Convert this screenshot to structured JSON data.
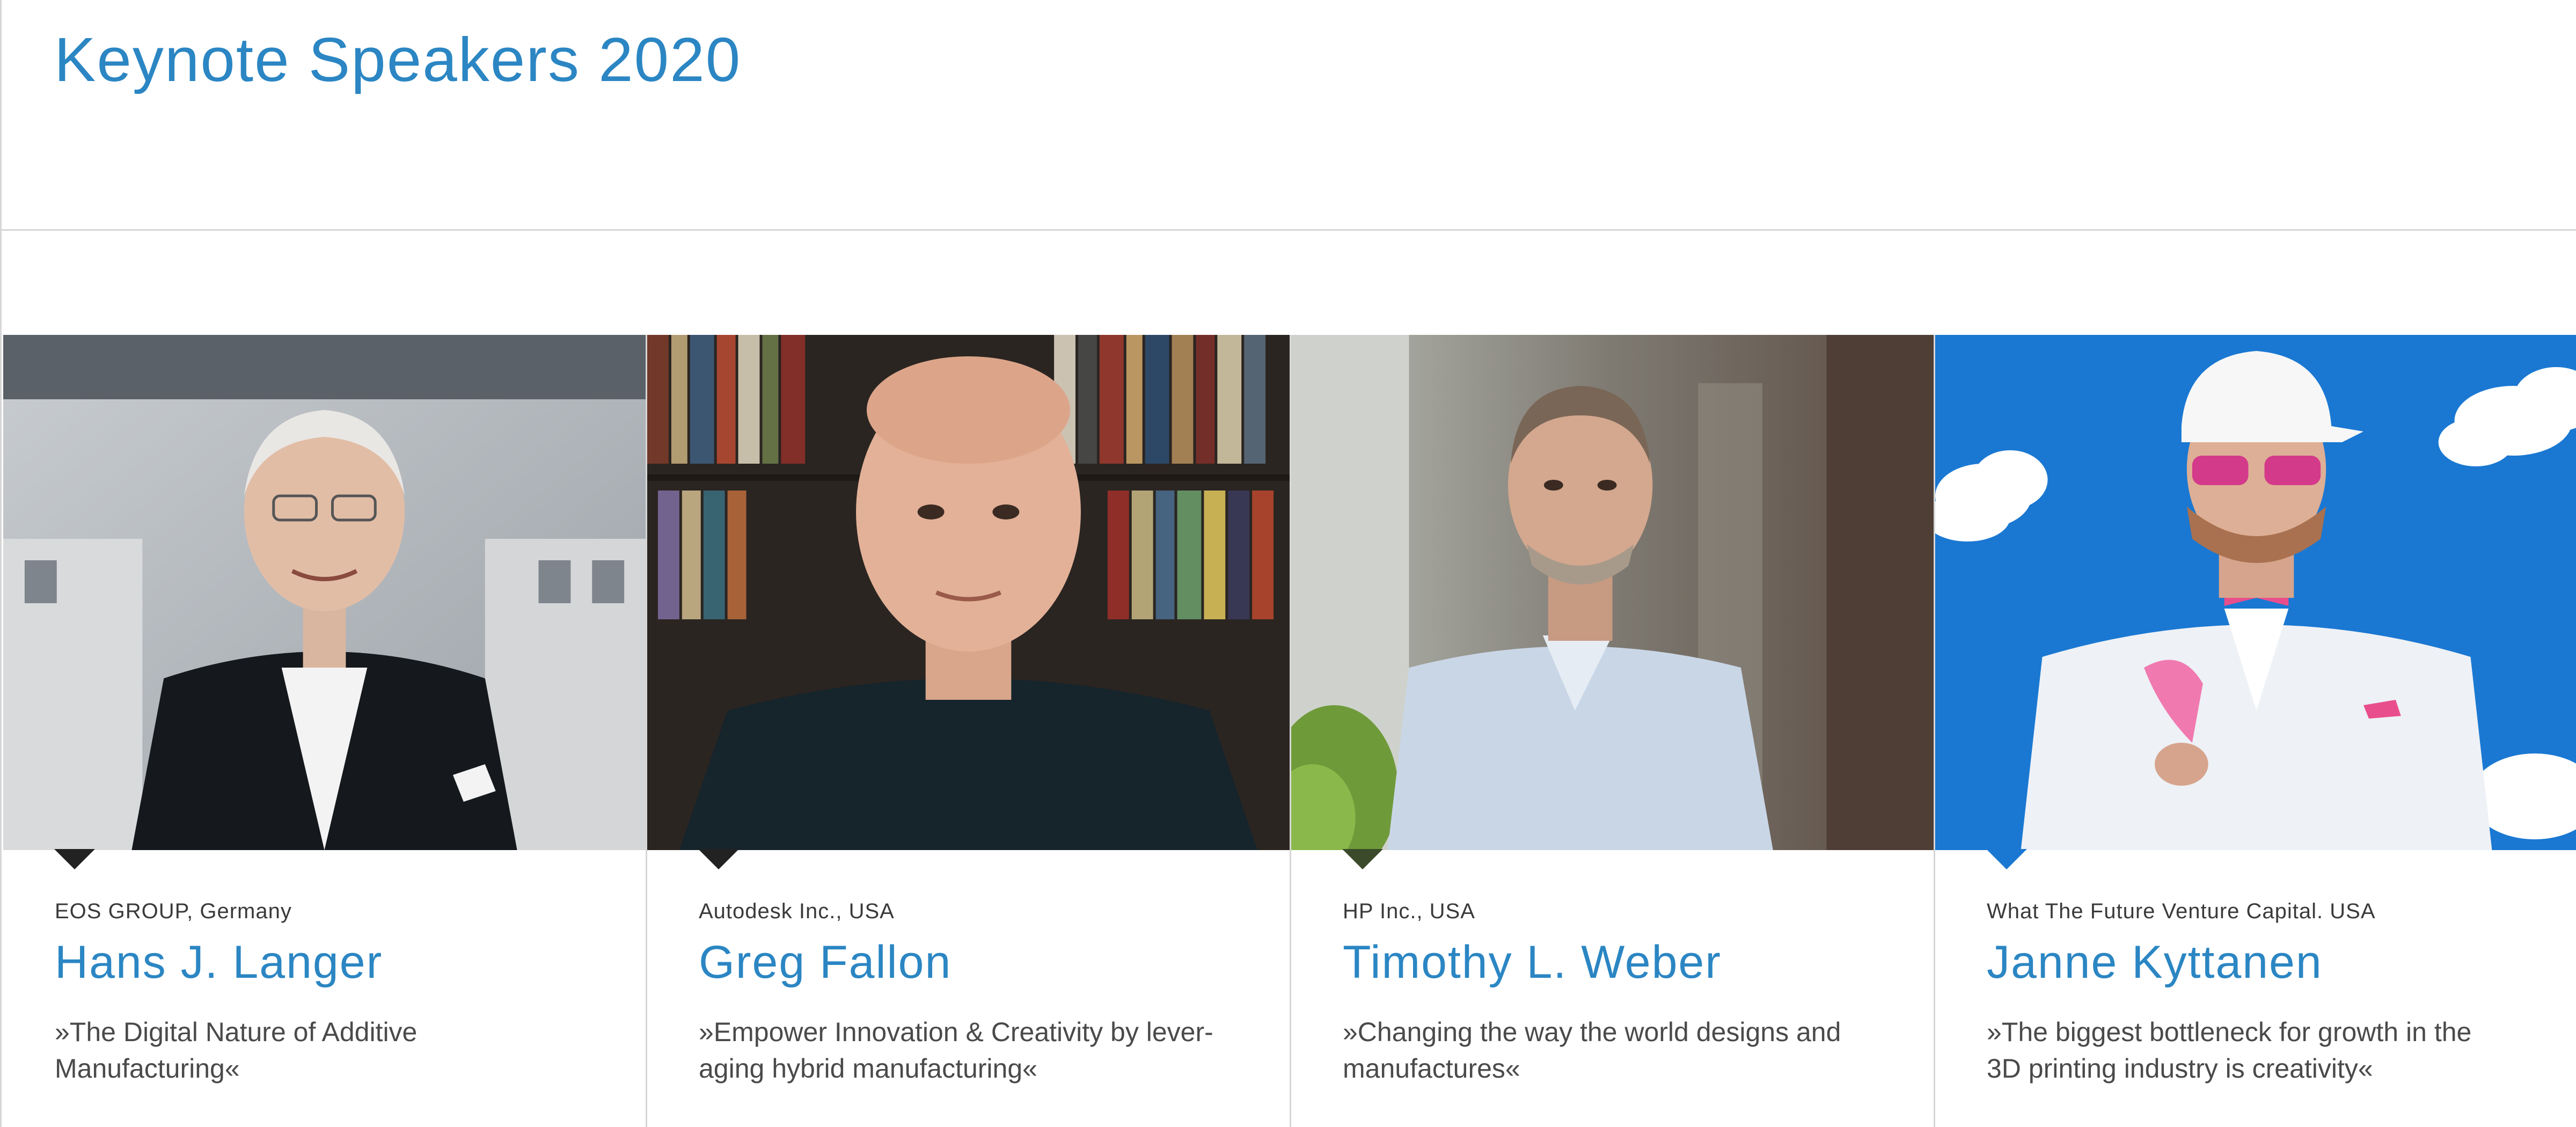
{
  "page": {
    "title": "Keynote Speakers 2020"
  },
  "speakers": [
    {
      "company": "EOS GROUP, Germany",
      "name": "Hans J. Langer",
      "quote_line1": "»The Digital Nature of Additive",
      "quote_line2": "Manufacturing«",
      "photo_icon": "portrait-photo"
    },
    {
      "company": "Autodesk Inc., USA",
      "name": "Greg Fallon",
      "quote_line1": "»Empower Innovation & Creativity by lever-",
      "quote_line2": "aging hybrid manufacturing«",
      "photo_icon": "portrait-photo"
    },
    {
      "company": "HP Inc., USA",
      "name": "Timothy L. Weber",
      "quote_line1": "»Changing the way the world designs and",
      "quote_line2": "manufactures«",
      "photo_icon": "portrait-photo"
    },
    {
      "company": "What The Future Venture Capital. USA",
      "name": "Janne Kyttanen",
      "quote_line1": "»The biggest bottleneck for growth in the",
      "quote_line2": "3D printing industry is creativity«",
      "photo_icon": "portrait-photo"
    }
  ],
  "colors": {
    "accent": "#2b86c3",
    "text": "#4a4a4a",
    "divider": "#d6d6d6"
  }
}
